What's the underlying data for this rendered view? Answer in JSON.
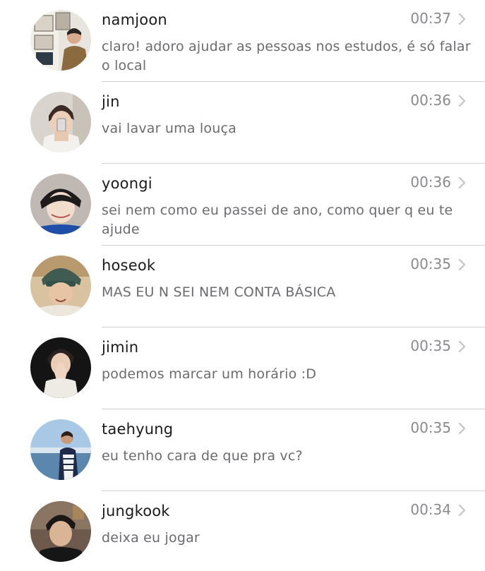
{
  "chats": [
    {
      "name": "namjoon",
      "time": "00:37",
      "message": "claro! adoro ajudar as pessoas nos estudos, é só falar o local",
      "avatar_icon": "avatar-photo-namjoon"
    },
    {
      "name": "jin",
      "time": "00:36",
      "message": "vai lavar uma louça",
      "avatar_icon": "avatar-photo-jin"
    },
    {
      "name": "yoongi",
      "time": "00:36",
      "message": "sei nem como eu passei de ano, como quer q eu te ajude",
      "avatar_icon": "avatar-photo-yoongi"
    },
    {
      "name": "hoseok",
      "time": "00:35",
      "message": "MAS EU N SEI NEM CONTA BÁSICA",
      "avatar_icon": "avatar-photo-hoseok"
    },
    {
      "name": "jimin",
      "time": "00:35",
      "message": "podemos marcar um horário :D",
      "avatar_icon": "avatar-photo-jimin"
    },
    {
      "name": "taehyung",
      "time": "00:35",
      "message": "eu tenho cara de que pra vc?",
      "avatar_icon": "avatar-photo-taehyung"
    },
    {
      "name": "jungkook",
      "time": "00:34",
      "message": "deixa eu jogar",
      "avatar_icon": "avatar-photo-jungkook"
    }
  ],
  "colors": {
    "name_text": "#1a1a1a",
    "message_text": "#6b6b70",
    "time_text": "#8a8a8f",
    "divider": "#cfcfd2",
    "chevron": "#c4c4c7"
  }
}
